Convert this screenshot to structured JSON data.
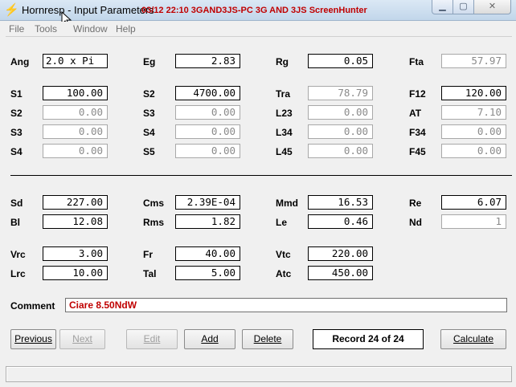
{
  "window": {
    "title": "Hornresp - Input Parameters",
    "overlay": "03/12  22:10  3GAND3JS-PC  3G AND 3JS  ScreenHunter",
    "controls": {
      "minimize": "▁",
      "maximize": "▢",
      "close": "✕"
    }
  },
  "menu": {
    "file": "File",
    "tools": "Tools",
    "window": "Window",
    "help": "Help"
  },
  "labels": {
    "ang": "Ang",
    "eg": "Eg",
    "rg": "Rg",
    "fta": "Fta",
    "s1": "S1",
    "s2b": "S2",
    "tra": "Tra",
    "f12": "F12",
    "s2": "S2",
    "s3b": "S3",
    "l23": "L23",
    "at": "AT",
    "s3": "S3",
    "s4b": "S4",
    "l34": "L34",
    "f34": "F34",
    "s4": "S4",
    "s5": "S5",
    "l45": "L45",
    "f45": "F45",
    "sd": "Sd",
    "cms": "Cms",
    "mmd": "Mmd",
    "re": "Re",
    "bl": "Bl",
    "rms": "Rms",
    "le": "Le",
    "nd": "Nd",
    "vrc": "Vrc",
    "fr": "Fr",
    "vtc": "Vtc",
    "lrc": "Lrc",
    "tal": "Tal",
    "atc": "Atc",
    "comment": "Comment"
  },
  "values": {
    "ang": "2.0 x Pi",
    "eg": "2.83",
    "rg": "0.05",
    "fta": "57.97",
    "s1": "100.00",
    "s2b": "4700.00",
    "tra": "78.79",
    "f12": "120.00",
    "s2": "0.00",
    "s3b": "0.00",
    "l23": "0.00",
    "at": "7.10",
    "s3": "0.00",
    "s4b": "0.00",
    "l34": "0.00",
    "f34": "0.00",
    "s4": "0.00",
    "s5": "0.00",
    "l45": "0.00",
    "f45": "0.00",
    "sd": "227.00",
    "cms": "2.39E-04",
    "mmd": "16.53",
    "re": "6.07",
    "bl": "12.08",
    "rms": "1.82",
    "le": "0.46",
    "nd": "1",
    "vrc": "3.00",
    "fr": "40.00",
    "vtc": "220.00",
    "lrc": "10.00",
    "tal": "5.00",
    "atc": "450.00",
    "comment": "Ciare 8.50NdW"
  },
  "buttons": {
    "previous": "Previous",
    "next": "Next",
    "edit": "Edit",
    "add": "Add",
    "delete": "Delete",
    "calculate": "Calculate"
  },
  "record": "Record 24 of 24",
  "colors": {
    "accent_red": "#c00000",
    "disabled_gray": "#8a8a8a"
  }
}
